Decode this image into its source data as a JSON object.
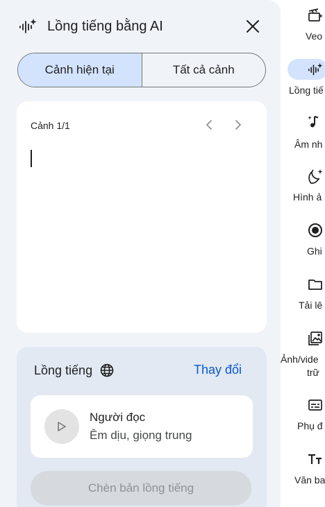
{
  "panel": {
    "title": "Lồng tiếng bằng AI",
    "tabs": [
      {
        "label": "Cảnh hiện tại",
        "active": true
      },
      {
        "label": "Tất cả cảnh",
        "active": false
      }
    ],
    "editor": {
      "scene_label": "Cảnh 1/1"
    },
    "voice": {
      "label": "Lồng tiếng",
      "change_label": "Thay đổi",
      "reader_name": "Người đọc",
      "reader_desc": "Êm dịu, giọng trung",
      "insert_label": "Chèn bản lồng tiếng"
    }
  },
  "rail": {
    "items": [
      {
        "label": "Veo",
        "icon": "clapper-sparkle-icon"
      },
      {
        "label": "Lồng tiế",
        "icon": "voice-sparkle-icon",
        "active": true
      },
      {
        "label": "Âm nh",
        "icon": "music-note-sparkle-icon"
      },
      {
        "label": "Hình ả",
        "icon": "banana-sparkle-icon"
      },
      {
        "label": "Ghi",
        "icon": "record-icon"
      },
      {
        "label": "Tải lê",
        "icon": "folder-icon"
      },
      {
        "label": "Ảnh/vide",
        "label2": "trữ",
        "icon": "media-library-icon"
      },
      {
        "label": "Phụ đ",
        "icon": "subtitles-icon"
      },
      {
        "label": "Văn ba",
        "icon": "text-icon"
      }
    ]
  },
  "colors": {
    "panel_bg": "#f0f4f9",
    "active_tab": "#d3e3fd",
    "link": "#0b57d0",
    "voice_card_bg": "#e2e9f3",
    "disabled_button": "#d6d9dd"
  }
}
